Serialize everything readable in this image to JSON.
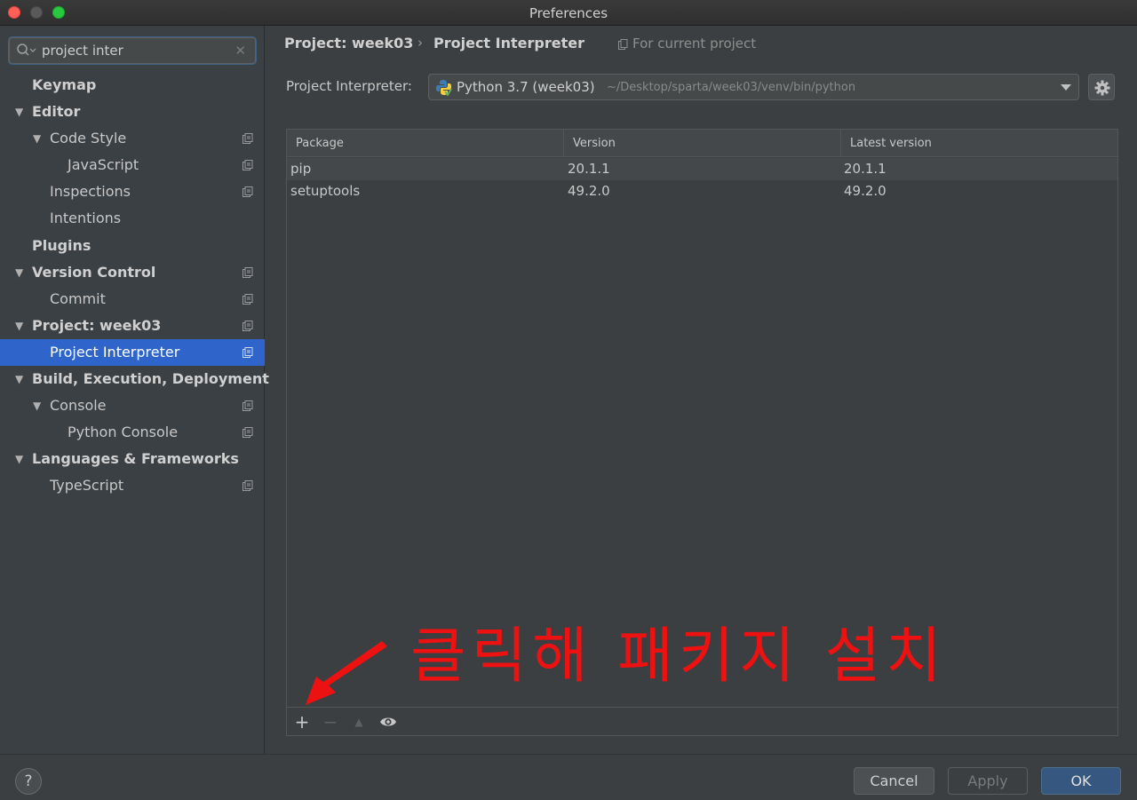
{
  "window": {
    "title": "Preferences"
  },
  "search": {
    "value": "project inter"
  },
  "sidebar": {
    "items": [
      {
        "label": "Keymap"
      },
      {
        "label": "Editor"
      },
      {
        "label": "Code Style"
      },
      {
        "label": "JavaScript"
      },
      {
        "label": "Inspections"
      },
      {
        "label": "Intentions"
      },
      {
        "label": "Plugins"
      },
      {
        "label": "Version Control"
      },
      {
        "label": "Commit"
      },
      {
        "label": "Project: week03"
      },
      {
        "label": "Project Interpreter"
      },
      {
        "label": "Build, Execution, Deployment"
      },
      {
        "label": "Console"
      },
      {
        "label": "Python Console"
      },
      {
        "label": "Languages & Frameworks"
      },
      {
        "label": "TypeScript"
      }
    ]
  },
  "breadcrumb": {
    "parent": "Project: week03",
    "separator": "›",
    "current": "Project Interpreter",
    "scope": "For current project"
  },
  "interpreter": {
    "label": "Project Interpreter:",
    "name": "Python 3.7 (week03)",
    "path": "~/Desktop/sparta/week03/venv/bin/python"
  },
  "table": {
    "headers": [
      "Package",
      "Version",
      "Latest version"
    ],
    "rows": [
      {
        "package": "pip",
        "version": "20.1.1",
        "latest": "20.1.1"
      },
      {
        "package": "setuptools",
        "version": "49.2.0",
        "latest": "49.2.0"
      }
    ]
  },
  "toolbar": {
    "add": "+",
    "remove": "−",
    "up": "▲"
  },
  "annotation": {
    "text": "클릭해 패키지 설치",
    "color": "#ee1111"
  },
  "footer": {
    "help": "?",
    "cancel": "Cancel",
    "apply": "Apply",
    "ok": "OK"
  },
  "colors": {
    "selection": "#2f65ca",
    "ok_button": "#365880",
    "background": "#3c3f41"
  }
}
